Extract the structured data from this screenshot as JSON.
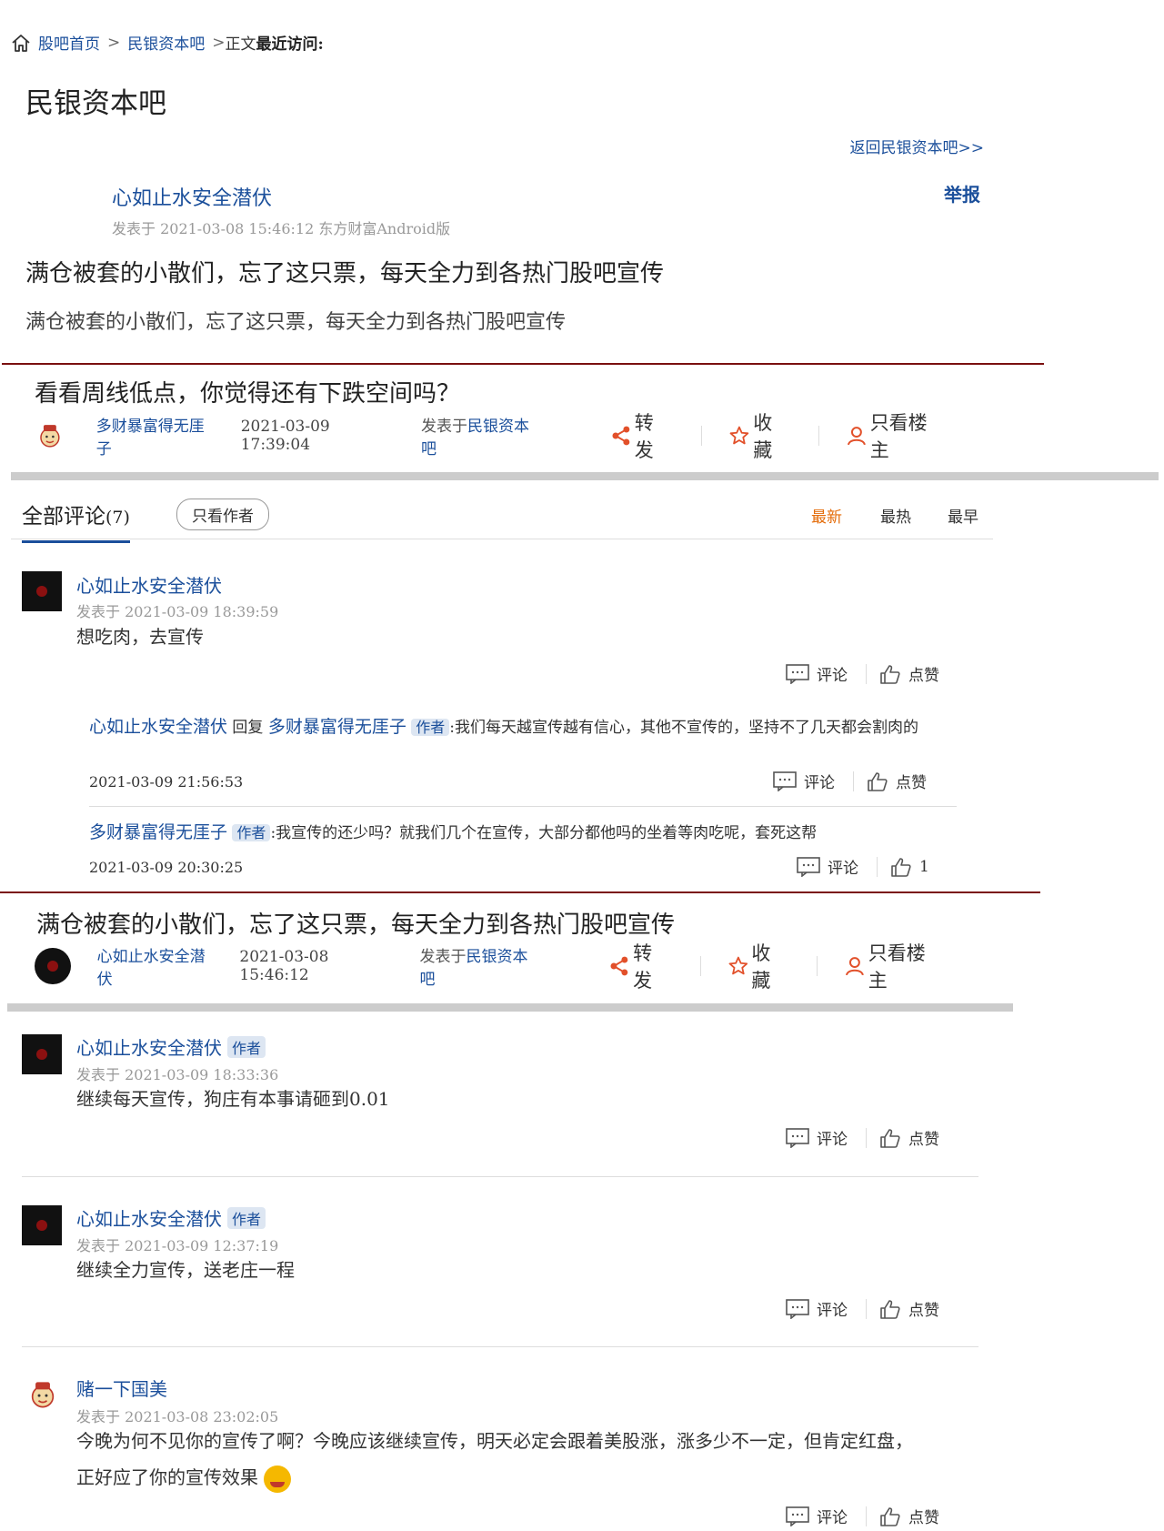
{
  "breadcrumb": {
    "home": "股吧首页",
    "sep": ">",
    "bar": "民银资本吧",
    "current": "正文",
    "recent": "最近访问:"
  },
  "bar_title": "民银资本吧",
  "back_link": "返回民银资本吧>>",
  "post": {
    "author": "心如止水安全潜伏",
    "report": "举报",
    "meta": "发表于 2021-03-08 15:46:12 东方财富Android版",
    "title": "满仓被套的小散们，忘了这只票，每天全力到各热门股吧宣传",
    "body": "满仓被套的小散们，忘了这只票，每天全力到各热门股吧宣传"
  },
  "quoted_post_1": {
    "title": "看看周线低点，你觉得还有下跌空间吗？",
    "nick": "多财暴富得无厓子",
    "date": "2021-03-09 17:39:04",
    "posted_in": "发表于",
    "bar": "民银资本吧",
    "share": "转发",
    "fav": "收藏",
    "only_owner": "只看楼主"
  },
  "comments_header": {
    "all": "全部评论",
    "count": "(7)",
    "only_author": "只看作者",
    "sort_new": "最新",
    "sort_hot": "最热",
    "sort_old": "最早"
  },
  "actions": {
    "comment": "评论",
    "like": "点赞"
  },
  "comment_1": {
    "nick": "心如止水安全潜伏",
    "meta": "发表于 2021-03-09 18:39:59",
    "text": "想吃肉，去宣传",
    "reply_1": {
      "nick": "心如止水安全潜伏",
      "reply_word": "回复",
      "target": "多财暴富得无厓子",
      "badge": "作者",
      "text": ":我们每天越宣传越有信心，其他不宣传的，坚持不了几天都会割肉的",
      "date": "2021-03-09 21:56:53"
    },
    "reply_2": {
      "nick": "多财暴富得无厓子",
      "badge": "作者",
      "text": ":我宣传的还少吗？就我们几个在宣传，大部分都他吗的坐着等肉吃呢，套死这帮",
      "date": "2021-03-09 20:30:25",
      "likes": "1"
    }
  },
  "quoted_post_2": {
    "title": "满仓被套的小散们，忘了这只票，每天全力到各热门股吧宣传",
    "nick": "心如止水安全潜伏",
    "date": "2021-03-08 15:46:12",
    "posted_in": "发表于",
    "bar": "民银资本吧",
    "share": "转发",
    "fav": "收藏",
    "only_owner": "只看楼主"
  },
  "comment_2": {
    "nick": "心如止水安全潜伏",
    "badge": "作者",
    "meta": "发表于 2021-03-09 18:33:36",
    "text": "继续每天宣传，狗庄有本事请砸到0.01"
  },
  "comment_3": {
    "nick": "心如止水安全潜伏",
    "badge": "作者",
    "meta": "发表于 2021-03-09 12:37:19",
    "text": "继续全力宣传，送老庄一程"
  },
  "comment_4": {
    "nick": "赌一下国美",
    "meta": "发表于 2021-03-08 23:02:05",
    "text_line1": "今晚为何不见你的宣传了啊？今晚应该继续宣传，明天必定会跟着美股涨，涨多少不一定，但肯定红盘，",
    "text_line2": "正好应了你的宣传效果"
  }
}
